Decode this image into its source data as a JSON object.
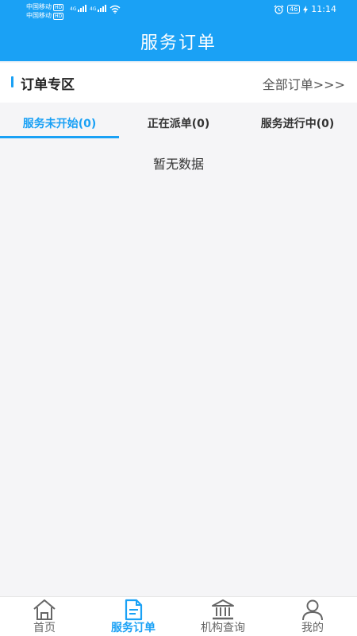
{
  "status_bar": {
    "carrier_1": "中国移动",
    "carrier_2": "中国移动",
    "hd_badge": "HD",
    "network_1": "4G",
    "network_2": "4G",
    "battery": "46",
    "time": "11:14"
  },
  "header": {
    "title": "服务订单"
  },
  "section": {
    "title": "订单专区",
    "all_orders": "全部订单>>>"
  },
  "tabs": [
    {
      "label": "服务未开始(0)",
      "active": true
    },
    {
      "label": "正在派单(0)",
      "active": false
    },
    {
      "label": "服务进行中(0)",
      "active": false
    }
  ],
  "empty_message": "暂无数据",
  "bottom_nav": [
    {
      "label": "首页",
      "icon": "home-icon"
    },
    {
      "label": "服务订单",
      "icon": "document-icon",
      "active": true
    },
    {
      "label": "机构查询",
      "icon": "institution-icon"
    },
    {
      "label": "我的",
      "icon": "user-icon"
    }
  ],
  "colors": {
    "primary": "#1aa1f5",
    "text": "#333333",
    "background": "#f5f5f7"
  }
}
